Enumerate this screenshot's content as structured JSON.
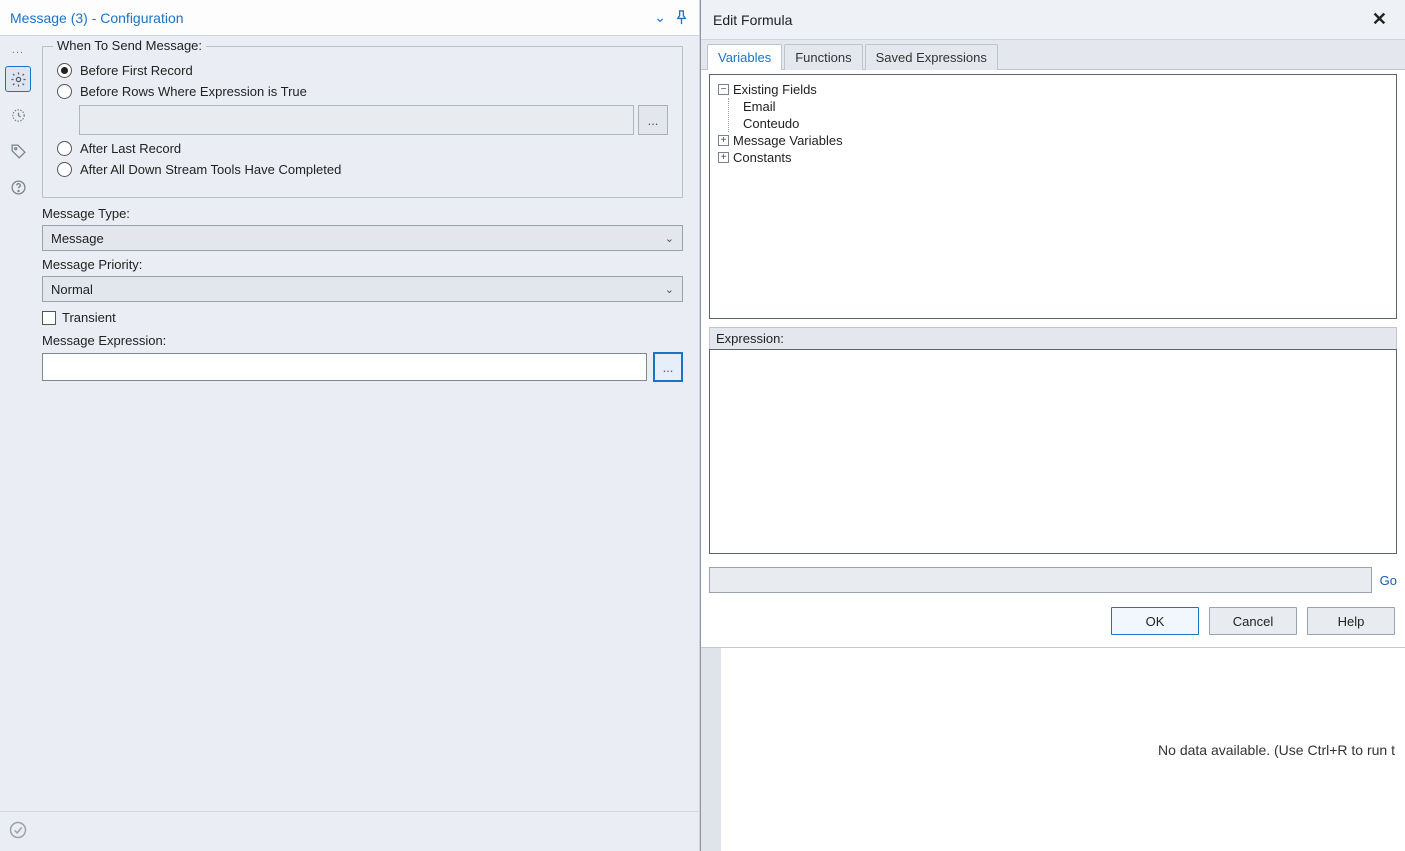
{
  "leftPanel": {
    "title": "Message (3) - Configuration",
    "kebab": "...",
    "whenToSend": {
      "legend": "When To Send Message:",
      "options": {
        "beforeFirst": {
          "label": "Before First Record",
          "checked": true
        },
        "beforeRowsExpr": {
          "label": "Before Rows Where Expression is True",
          "checked": false
        },
        "afterLast": {
          "label": "After Last Record",
          "checked": false
        },
        "afterDownstream": {
          "label": "After All Down Stream Tools Have Completed",
          "checked": false
        }
      },
      "expressionBtn": "..."
    },
    "messageType": {
      "label": "Message Type:",
      "value": "Message"
    },
    "messagePriority": {
      "label": "Message Priority:",
      "value": "Normal"
    },
    "transient": {
      "label": "Transient",
      "checked": false
    },
    "messageExpression": {
      "label": "Message Expression:",
      "value": "",
      "btn": "..."
    }
  },
  "rightPanel": {
    "title": "Edit Formula",
    "tabs": {
      "variables": "Variables",
      "functions": "Functions",
      "saved": "Saved Expressions"
    },
    "tree": {
      "existingFields": {
        "label": "Existing Fields",
        "expanded": true,
        "children": [
          "Email",
          "Conteudo"
        ]
      },
      "messageVariables": {
        "label": "Message Variables",
        "expanded": false
      },
      "constants": {
        "label": "Constants",
        "expanded": false
      }
    },
    "expression": {
      "label": "Expression:",
      "value": ""
    },
    "goRow": {
      "input": "",
      "goLabel": "Go"
    },
    "buttons": {
      "ok": "OK",
      "cancel": "Cancel",
      "help": "Help"
    }
  },
  "statusBar": {
    "message": "No data available. (Use Ctrl+R to run t"
  }
}
